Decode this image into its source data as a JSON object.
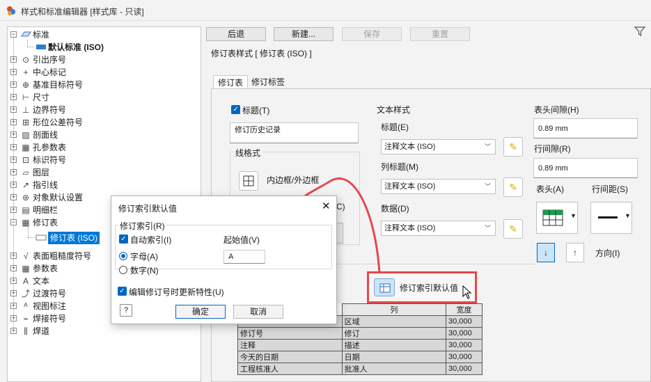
{
  "window": {
    "title": "样式和标准编辑器 [样式库 - 只读]"
  },
  "tree": {
    "root": "标准",
    "default_std": "默认标准 (ISO)",
    "items": [
      "引出序号",
      "中心标记",
      "基准目标符号",
      "尺寸",
      "边界符号",
      "形位公差符号",
      "剖面线",
      "孔参数表",
      "标识符号",
      "图层",
      "指引线",
      "对象默认设置",
      "明细栏",
      "修订表"
    ],
    "revision_child": "修订表 (ISO)",
    "items_after": [
      "表面粗糙度符号",
      "参数表",
      "文本",
      "过渡符号",
      "视图标注",
      "焊接符号",
      "焊道"
    ]
  },
  "toolbar": {
    "back": "后退",
    "new": "新建...",
    "save": "保存",
    "reset": "重置"
  },
  "style_header": "修订表样式 [ 修订表 (ISO) ]",
  "tabs": [
    "修订表",
    "修订标签"
  ],
  "main": {
    "title_label": "标题(T)",
    "title_value": "修订历史记录",
    "line_format": "线格式",
    "inner_outer": "内边框/外边框",
    "partial_c": "C)",
    "text_style": "文本样式",
    "title_sub": "标题(E)",
    "col_title": "列标题(M)",
    "data": "数据(D)",
    "combo_value": "注释文本 (ISO)",
    "header_gap": "表头间隙(H)",
    "header_gap_value": "0.89 mm",
    "row_gap": "行间隙(R)",
    "row_gap_value": "0.89 mm",
    "header_pos": "表头(A)",
    "row_spacing": "行间距(S)",
    "direction": "方向(I)",
    "rev_index_default": "修订索引默认值"
  },
  "table": {
    "headers": [
      "列",
      "宽度"
    ],
    "rows": [
      [
        "",
        "区域",
        "30,000"
      ],
      [
        "修订号",
        "修订",
        "30,000"
      ],
      [
        "注释",
        "描述",
        "30,000"
      ],
      [
        "今天的日期",
        "日期",
        "30,000"
      ],
      [
        "工程核准人",
        "批准人",
        "30,000"
      ]
    ]
  },
  "dialog": {
    "title": "修订索引默认值",
    "group": "修订索引(R)",
    "auto_index": "自动索引(I)",
    "start_label": "起始值(V)",
    "start_value": "A",
    "letter": "字母(A)",
    "number": "数字(N)",
    "update_props": "编辑修订号时更新特性(U)",
    "ok": "确定",
    "cancel": "取消"
  },
  "colors": {
    "accent": "#0067c0",
    "highlight": "#0078d7",
    "callout": "#e5484d"
  }
}
